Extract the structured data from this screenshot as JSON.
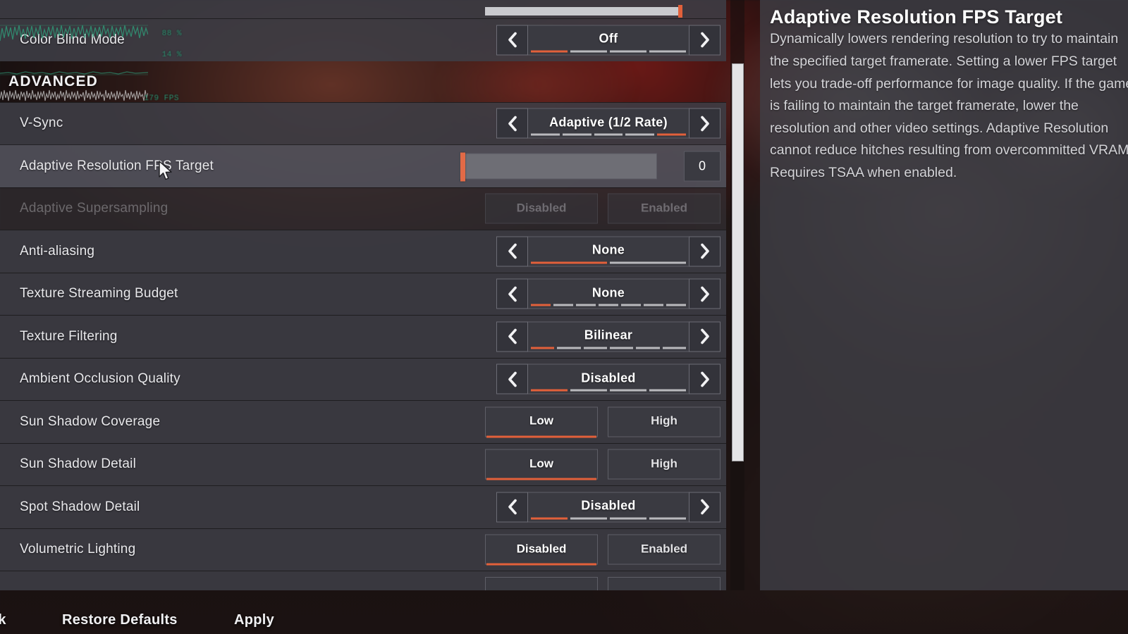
{
  "colors": {
    "accent_orange": "#e2603a",
    "row_bg": "#3e3e46",
    "row_bg_alt": "#46464f",
    "row_bg_selected": "#52525c",
    "panel_bg": "#404048",
    "text_primary": "#ffffff",
    "text_secondary": "#d3d3d7",
    "segment_inactive": "#b9b9bd",
    "overlay_green": "#2f9e7a",
    "scrollbar_thumb": "#e4e4e6"
  },
  "perf_overlay": {
    "rows": [
      {
        "name": "gpu-usage",
        "value": "88 %"
      },
      {
        "name": "cpu-usage",
        "value": "14 %"
      },
      {
        "name": "framerate",
        "value": "179 FPS"
      }
    ]
  },
  "section": {
    "title": "ADVANCED"
  },
  "partial_top_row": {
    "name": "partial-slider-row",
    "control": "slider",
    "fill_percent": 96
  },
  "rows": [
    {
      "label": "Color Blind Mode",
      "control": "spinner",
      "value": "Off",
      "segments": 4,
      "active_index": 0,
      "disabled": false,
      "selected": false
    },
    {
      "label": "V-Sync",
      "control": "spinner",
      "value": "Adaptive (1/2 Rate)",
      "segments": 5,
      "active_index": 4,
      "disabled": false,
      "selected": false
    },
    {
      "label": "Adaptive Resolution FPS Target",
      "control": "slider",
      "value": "0",
      "slider_percent": 0,
      "disabled": false,
      "selected": true
    },
    {
      "label": "Adaptive Supersampling",
      "control": "toggle",
      "options": [
        "Disabled",
        "Enabled"
      ],
      "active_index": -1,
      "disabled": true,
      "selected": false
    },
    {
      "label": "Anti-aliasing",
      "control": "spinner",
      "value": "None",
      "segments": 2,
      "active_index": 0,
      "disabled": false,
      "selected": false
    },
    {
      "label": "Texture Streaming Budget",
      "control": "spinner",
      "value": "None",
      "segments": 7,
      "active_index": 0,
      "disabled": false,
      "selected": false
    },
    {
      "label": "Texture Filtering",
      "control": "spinner",
      "value": "Bilinear",
      "segments": 6,
      "active_index": 0,
      "disabled": false,
      "selected": false
    },
    {
      "label": "Ambient Occlusion Quality",
      "control": "spinner",
      "value": "Disabled",
      "segments": 4,
      "active_index": 0,
      "disabled": false,
      "selected": false
    },
    {
      "label": "Sun Shadow Coverage",
      "control": "toggle",
      "options": [
        "Low",
        "High"
      ],
      "active_index": 0,
      "disabled": false,
      "selected": false
    },
    {
      "label": "Sun Shadow Detail",
      "control": "toggle",
      "options": [
        "Low",
        "High"
      ],
      "active_index": 0,
      "disabled": false,
      "selected": false
    },
    {
      "label": "Spot Shadow Detail",
      "control": "spinner",
      "value": "Disabled",
      "segments": 4,
      "active_index": 0,
      "disabled": false,
      "selected": false
    },
    {
      "label": "Volumetric Lighting",
      "control": "toggle",
      "options": [
        "Disabled",
        "Enabled"
      ],
      "active_index": 0,
      "disabled": false,
      "selected": false
    }
  ],
  "partial_bottom_row": {
    "name": "partial-toggle-row",
    "control": "toggle",
    "options": [
      "",
      ""
    ]
  },
  "description": {
    "title": "Adaptive Resolution FPS Target",
    "body": "Dynamically lowers rendering resolution to try to maintain the specified target framerate. Setting a lower FPS target lets you trade-off performance for image quality. If the game is failing to maintain the target framerate, lower the resolution and other video settings. Adaptive Resolution cannot reduce hitches resulting from overcommitted VRAM. Requires TSAA when enabled."
  },
  "bottom_bar": {
    "back": "ck",
    "restore_defaults": "Restore Defaults",
    "apply": "Apply"
  }
}
